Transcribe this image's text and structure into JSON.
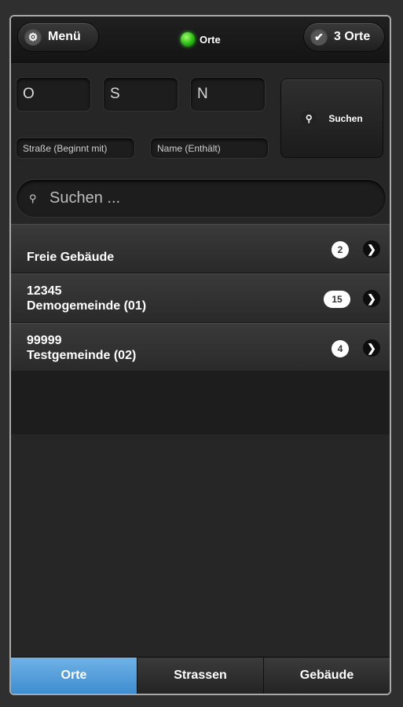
{
  "header": {
    "menu_label": "Menü",
    "status_label": "Orte",
    "count_label": "3 Orte"
  },
  "icons": {
    "menu": "gear-icon",
    "count": "checkmark-icon",
    "search": "search-icon",
    "chevron": "chevron-right-icon"
  },
  "filters": {
    "o": "O",
    "s": "S",
    "n": "N",
    "street_placeholder": "Straße (Beginnt mit)",
    "name_placeholder": "Name (Enthält)",
    "search_button": "Suchen"
  },
  "search": {
    "placeholder": "Suchen ..."
  },
  "list": [
    {
      "line1": "",
      "line2": "Freie Gebäude",
      "count": "2"
    },
    {
      "line1": "12345",
      "line2": "Demogemeinde (01)",
      "count": "15"
    },
    {
      "line1": "99999",
      "line2": "Testgemeinde (02)",
      "count": "4"
    }
  ],
  "tabs": [
    "Orte",
    "Strassen",
    "Gebäude"
  ],
  "colors": {
    "active_tab": "#4a9ad8",
    "status_led": "#2bbb16"
  }
}
